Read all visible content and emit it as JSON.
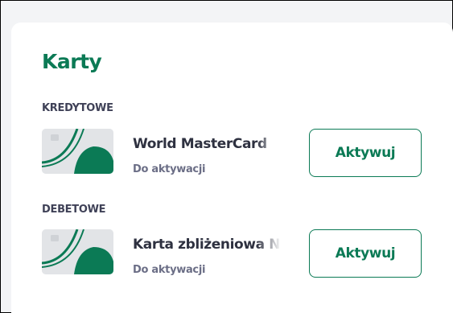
{
  "section": {
    "title": "Karty"
  },
  "groups": [
    {
      "label": "KREDYTOWE",
      "card": {
        "name": "World MasterCard",
        "status": "Do aktywacji",
        "action_label": "Aktywuj"
      }
    },
    {
      "label": "DEBETOWE",
      "card": {
        "name": "Karta zbliżeniowa N",
        "status": "Do aktywacji",
        "action_label": "Aktywuj"
      }
    }
  ],
  "colors": {
    "brand_green": "#0b7a55",
    "text_dark": "#2e3140",
    "text_muted": "#6b6e86",
    "panel_bg": "#ffffff",
    "page_bg": "#f3f4f6"
  },
  "icons": {
    "card_thumbnail": "bank-card-icon"
  }
}
